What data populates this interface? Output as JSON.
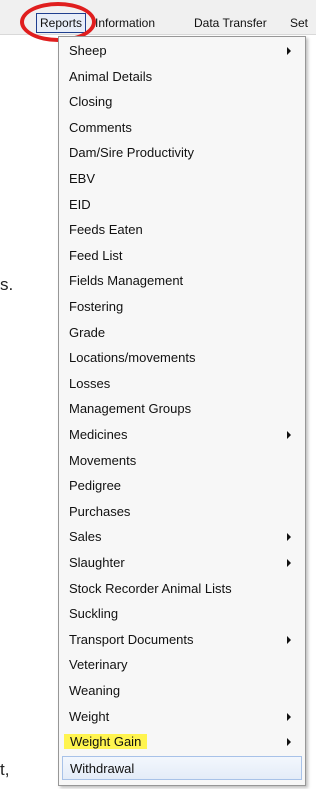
{
  "menubar": {
    "items": [
      "Reports",
      "Information",
      "Data Transfer",
      "Set"
    ]
  },
  "fragments": {
    "text1": "s.",
    "text2": "t,"
  },
  "reports_menu": {
    "items": [
      {
        "label": "Sheep",
        "submenu": true
      },
      {
        "label": "Animal Details",
        "submenu": false
      },
      {
        "label": "Closing",
        "submenu": false
      },
      {
        "label": "Comments",
        "submenu": false
      },
      {
        "label": "Dam/Sire Productivity",
        "submenu": false
      },
      {
        "label": "EBV",
        "submenu": false
      },
      {
        "label": "EID",
        "submenu": false
      },
      {
        "label": "Feeds Eaten",
        "submenu": false
      },
      {
        "label": "Feed List",
        "submenu": false
      },
      {
        "label": "Fields Management",
        "submenu": false
      },
      {
        "label": "Fostering",
        "submenu": false
      },
      {
        "label": "Grade",
        "submenu": false
      },
      {
        "label": "Locations/movements",
        "submenu": false
      },
      {
        "label": "Losses",
        "submenu": false
      },
      {
        "label": "Management Groups",
        "submenu": false
      },
      {
        "label": "Medicines",
        "submenu": true
      },
      {
        "label": "Movements",
        "submenu": false
      },
      {
        "label": "Pedigree",
        "submenu": false
      },
      {
        "label": "Purchases",
        "submenu": false
      },
      {
        "label": "Sales",
        "submenu": true
      },
      {
        "label": "Slaughter",
        "submenu": true
      },
      {
        "label": "Stock Recorder Animal Lists",
        "submenu": false
      },
      {
        "label": "Suckling",
        "submenu": false
      },
      {
        "label": "Transport Documents",
        "submenu": true
      },
      {
        "label": "Veterinary",
        "submenu": false
      },
      {
        "label": "Weaning",
        "submenu": false
      },
      {
        "label": "Weight",
        "submenu": true
      },
      {
        "label": "Weight Gain",
        "submenu": true,
        "highlighted": true
      },
      {
        "label": "Withdrawal",
        "submenu": false,
        "hovered": true
      }
    ]
  },
  "colors": {
    "highlight": "#fff44f",
    "annotation_ring": "#e01e1e",
    "hover_border": "#a8c2e8"
  }
}
